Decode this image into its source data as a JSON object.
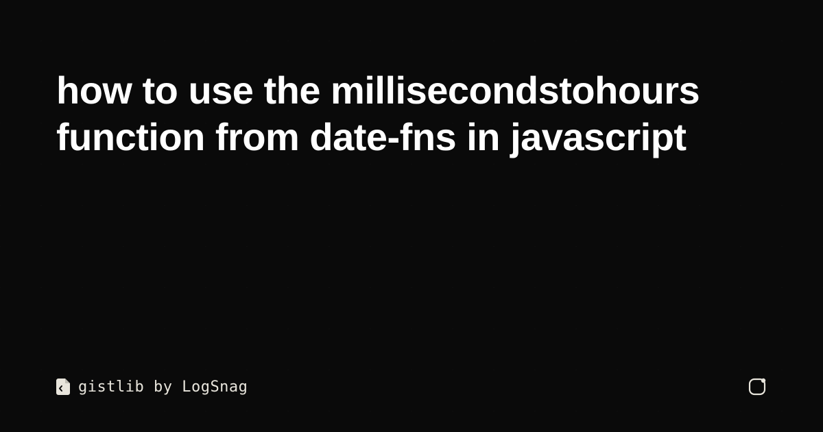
{
  "title": "how to use the millisecondstohours function from date-fns in javascript",
  "footer": {
    "brand_name": "gistlib",
    "by_text": " by ",
    "company": "LogSnag"
  },
  "colors": {
    "background": "#0a0a0a",
    "text_primary": "#ffffff",
    "text_secondary": "#e8e5dc"
  }
}
